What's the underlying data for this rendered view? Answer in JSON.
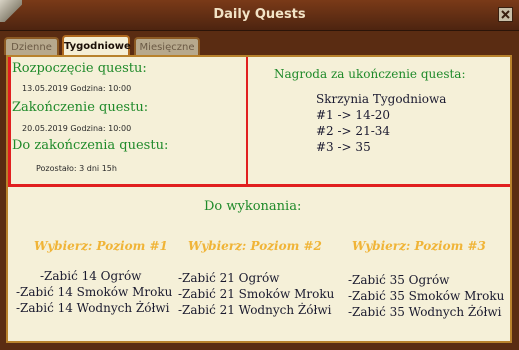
{
  "window": {
    "title": "Daily Quests",
    "close_icon": "close-icon"
  },
  "tabs": [
    {
      "label": "Dzienne"
    },
    {
      "label": "Tygodniowe"
    },
    {
      "label": "Miesięczne"
    }
  ],
  "left": {
    "start_heading": "Rozpoczęcie questu:",
    "start_value": "13.05.2019 Godzina: 10:00",
    "end_heading": "Zakończenie questu:",
    "end_value": "20.05.2019 Godzina: 10:00",
    "remaining_heading": "Do zakończenia questu:",
    "remaining_value": "Pozostało: 3 dni 15h"
  },
  "reward": {
    "heading": "Nagroda za ukończenie questa:",
    "lines": [
      "Skrzynia Tygodniowa",
      "#1 -> 14-20",
      "#2 -> 21-34",
      "#3 -> 35"
    ]
  },
  "todo": {
    "heading": "Do wykonania:",
    "levels": [
      {
        "title": "Wybierz: Poziom #1",
        "tasks": [
          "-Zabić 14 Ogrów",
          "-Zabić 14 Smoków Mroku",
          "-Zabić 14 Wodnych Żółwi"
        ]
      },
      {
        "title": "Wybierz: Poziom #2",
        "tasks": [
          "-Zabić 21 Ogrów",
          "-Zabić 21 Smoków Mroku",
          "-Zabić 21 Wodnych Żółwi"
        ]
      },
      {
        "title": "Wybierz: Poziom #3",
        "tasks": [
          "-Zabić 35 Ogrów",
          "-Zabić 35 Smoków Mroku",
          "-Zabić 35 Wodnych Żółwi"
        ]
      }
    ]
  },
  "colors": {
    "accent_red": "#e11f1f",
    "heading_green": "#1f8a2a",
    "level_yellow": "#f0b437"
  }
}
